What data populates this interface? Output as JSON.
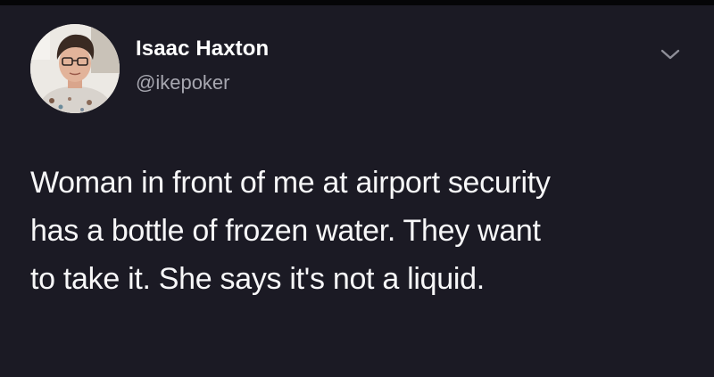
{
  "tweet": {
    "author": {
      "display_name": "Isaac Haxton",
      "handle": "@ikepoker",
      "avatar_icon": "profile-photo"
    },
    "text_lines": [
      "Woman in front of me at airport security",
      "has a bottle of frozen water. They want",
      "to take it. She says it's not a liquid."
    ],
    "menu_icon": "chevron-down-icon"
  },
  "colors": {
    "background": "#1b1a24",
    "text": "#f7f7f8",
    "handle": "#a7a7b0"
  }
}
